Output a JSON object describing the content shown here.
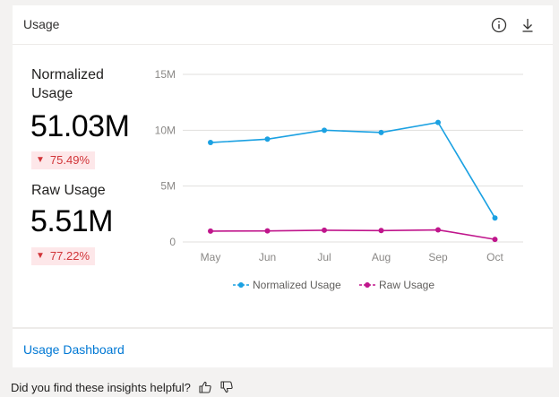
{
  "card": {
    "title": "Usage",
    "info_icon": "info-icon",
    "download_icon": "download-icon",
    "footer_link": "Usage Dashboard"
  },
  "metrics": {
    "normalized": {
      "label": "Normalized Usage",
      "value": "51.03M",
      "delta": "75.49%",
      "delta_direction": "down"
    },
    "raw": {
      "label": "Raw Usage",
      "value": "5.51M",
      "delta": "77.22%",
      "delta_direction": "down"
    }
  },
  "chart_data": {
    "type": "line",
    "categories": [
      "May",
      "Jun",
      "Jul",
      "Aug",
      "Sep",
      "Oct"
    ],
    "y_ticks": [
      "0",
      "5M",
      "10M",
      "15M"
    ],
    "ylim": [
      0,
      15000000
    ],
    "grid": true,
    "legend_position": "bottom-center",
    "series": [
      {
        "name": "Normalized Usage",
        "color": "#1ba1e2",
        "values": [
          8900000,
          9200000,
          10000000,
          9800000,
          10700000,
          2150000
        ]
      },
      {
        "name": "Raw Usage",
        "color": "#c0168c",
        "values": [
          970000,
          990000,
          1050000,
          1020000,
          1080000,
          230000
        ]
      }
    ]
  },
  "feedback": {
    "prompt": "Did you find these insights helpful?",
    "thumbs_up_icon": "thumbs-up-icon",
    "thumbs_down_icon": "thumbs-down-icon"
  },
  "colors": {
    "accent": "#0078d4",
    "negative": "#d13438",
    "negative_bg": "#fde7e9"
  }
}
